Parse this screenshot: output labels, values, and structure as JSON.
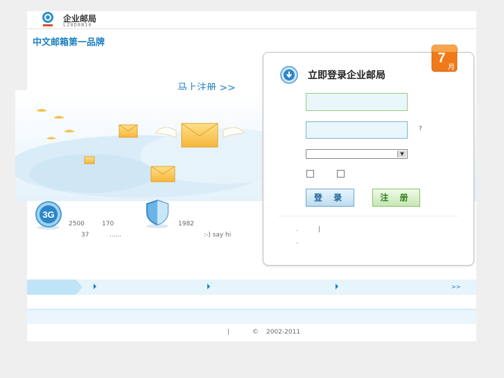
{
  "brand": {
    "name": "企业邮局",
    "sub": "L20D8B10",
    "slogan": "中文邮箱第一品牌"
  },
  "promo": {
    "register_link": "马上注册 >>"
  },
  "login": {
    "title": "立即登录企业邮局",
    "badge_number": "7",
    "badge_month": "月",
    "username_value": "",
    "password_value": "",
    "help_mark": "?",
    "select_value": "",
    "login_button": "登 录",
    "register_button": "注 册",
    "link_dot1": ".",
    "link_sep": "|",
    "link_dot2": "."
  },
  "features": {
    "badge_3g": "3G",
    "num_2500": "2500",
    "num_170": "170",
    "num_37": "37",
    "ellipsis": "......",
    "num_1982": "1982",
    "say_hi": ":-) say hi"
  },
  "nav": {
    "more": ">>"
  },
  "footer": {
    "sep": "|",
    "copyright_symbol": "©",
    "years": "2002-2011"
  },
  "colors": {
    "accent": "#1a7fc1",
    "badge": "#f07a1a",
    "register_green": "#2f7d1d"
  }
}
